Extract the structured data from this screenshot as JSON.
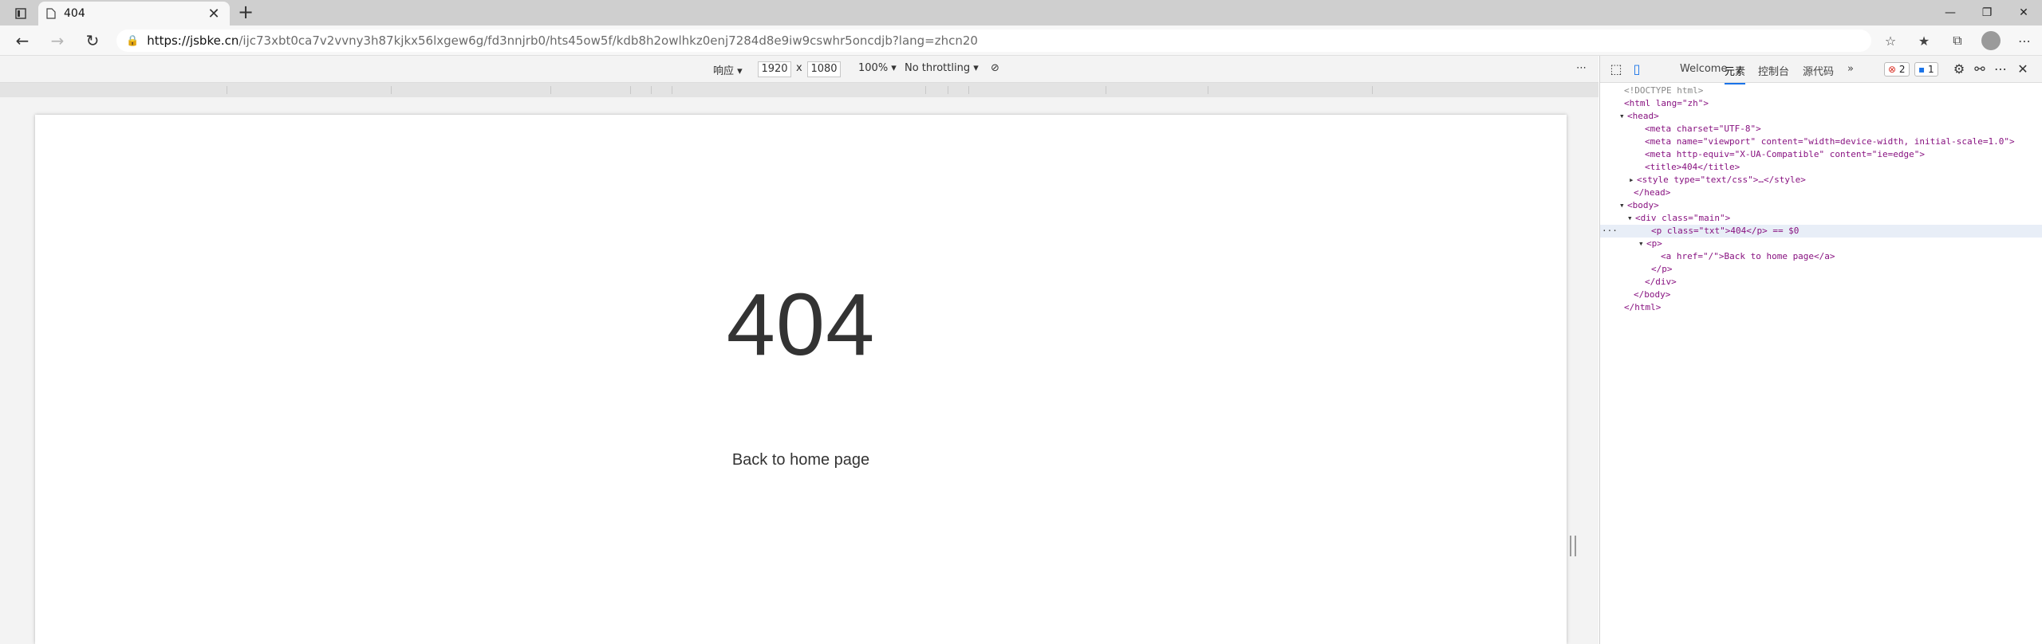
{
  "browser": {
    "tab_title": "404",
    "url_host": "https://jsbke.cn",
    "url_path": "/ijc73xbt0ca7v2vvny3h87kjkx56lxgew6g/fd3nnjrb0/hts45ow5f/kdb8h2owlhkz0enj7284d8e9iw9cswhr5oncdjb?lang=zhcn20"
  },
  "device_toolbar": {
    "device": "响应",
    "width": "1920",
    "x": "x",
    "height": "1080",
    "zoom": "100%",
    "throttling": "No throttling"
  },
  "page": {
    "heading": "404",
    "link": "Back to home page"
  },
  "devtools": {
    "tabs": [
      "Welcome",
      "元素",
      "控制台",
      "源代码"
    ],
    "errors": "2",
    "messages": "1",
    "dom": [
      {
        "t": "<!DOCTYPE html>"
      },
      {
        "t": "<html lang=\"zh\">"
      },
      {
        "t": "<head>"
      },
      {
        "t": "<meta charset=\"UTF-8\">"
      },
      {
        "t": "<meta name=\"viewport\" content=\"width=device-width, initial-scale=1.0\">"
      },
      {
        "t": "<meta http-equiv=\"X-UA-Compatible\" content=\"ie=edge\">"
      },
      {
        "t": "<title>404</title>"
      },
      {
        "t": "<style type=\"text/css\">…</style>"
      },
      {
        "t": "</head>"
      },
      {
        "t": "<body>"
      },
      {
        "t": "<div class=\"main\">"
      },
      {
        "t": "<p class=\"txt\">404</p> == $0"
      },
      {
        "t": "<p>"
      },
      {
        "t": "<a href=\"/\">Back to home page</a>"
      },
      {
        "t": "</p>"
      },
      {
        "t": "</div>"
      },
      {
        "t": "</body>"
      },
      {
        "t": "</html>"
      }
    ]
  }
}
